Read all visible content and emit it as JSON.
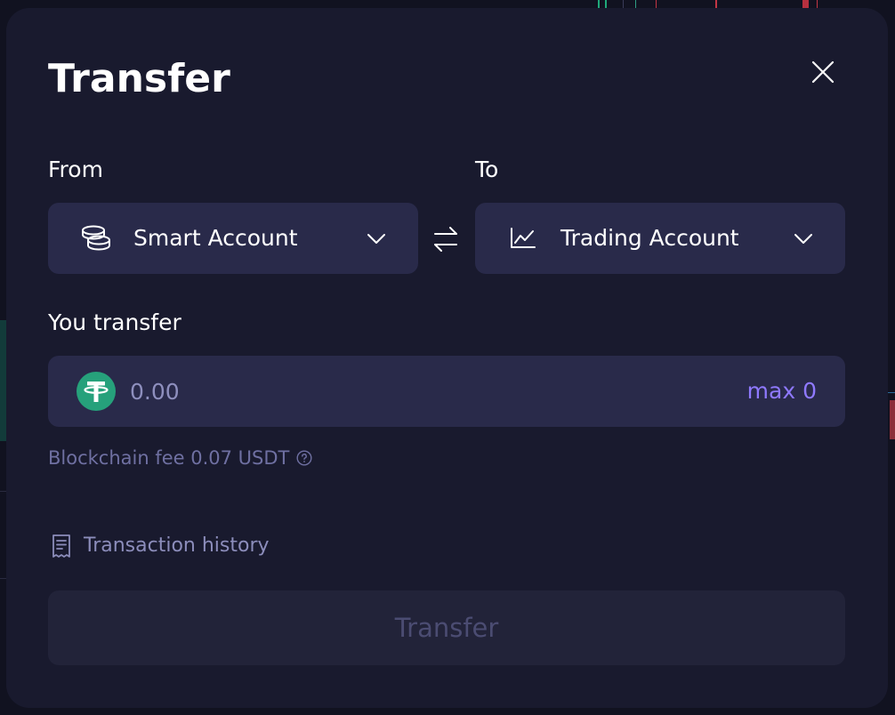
{
  "modal": {
    "title": "Transfer",
    "from_label": "From",
    "to_label": "To",
    "from_account": {
      "label": "Smart Account",
      "icon": "coins-icon"
    },
    "to_account": {
      "label": "Trading Account",
      "icon": "chart-line-icon"
    },
    "amount_label": "You transfer",
    "amount": {
      "placeholder": "0.00",
      "value": "",
      "currency_icon": "usdt-icon",
      "max_label": "max 0"
    },
    "fee_text": "Blockchain fee 0.07 USDT",
    "history_label": "Transaction history",
    "submit_label": "Transfer"
  },
  "colors": {
    "backdrop": "#111220",
    "modal_bg": "#191a2e",
    "field_bg": "#292a4a",
    "accent": "#8f79ff",
    "usdt": "#26a17b",
    "muted_text": "#6f70a2",
    "disabled_button_bg": "#222339",
    "disabled_button_text": "#4b4c72"
  }
}
